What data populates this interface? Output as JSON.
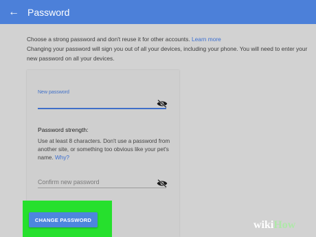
{
  "header": {
    "back_icon": "arrow-left-icon",
    "title": "Password"
  },
  "intro": {
    "line1_text": "Choose a strong password and don't reuse it for other accounts.",
    "learn_more": "Learn more",
    "line2": "Changing your password will sign you out of all your devices, including your phone. You will need to enter your new password on all your devices."
  },
  "form": {
    "new_password_label": "New password",
    "visibility_icon": "eye-off-icon",
    "strength_title": "Password strength:",
    "strength_text": "Use at least 8 characters. Don't use a password from another site, or something too obvious like your pet's name.",
    "why": "Why?",
    "confirm_placeholder": "Confirm new password",
    "submit_label": "CHANGE PASSWORD"
  },
  "watermark": {
    "part1": "wiki",
    "part2": "How"
  },
  "colors": {
    "header_bg": "#4c80d9",
    "link": "#3b6fd1",
    "button_bg": "#4d86de",
    "highlight": "#26e02d"
  }
}
